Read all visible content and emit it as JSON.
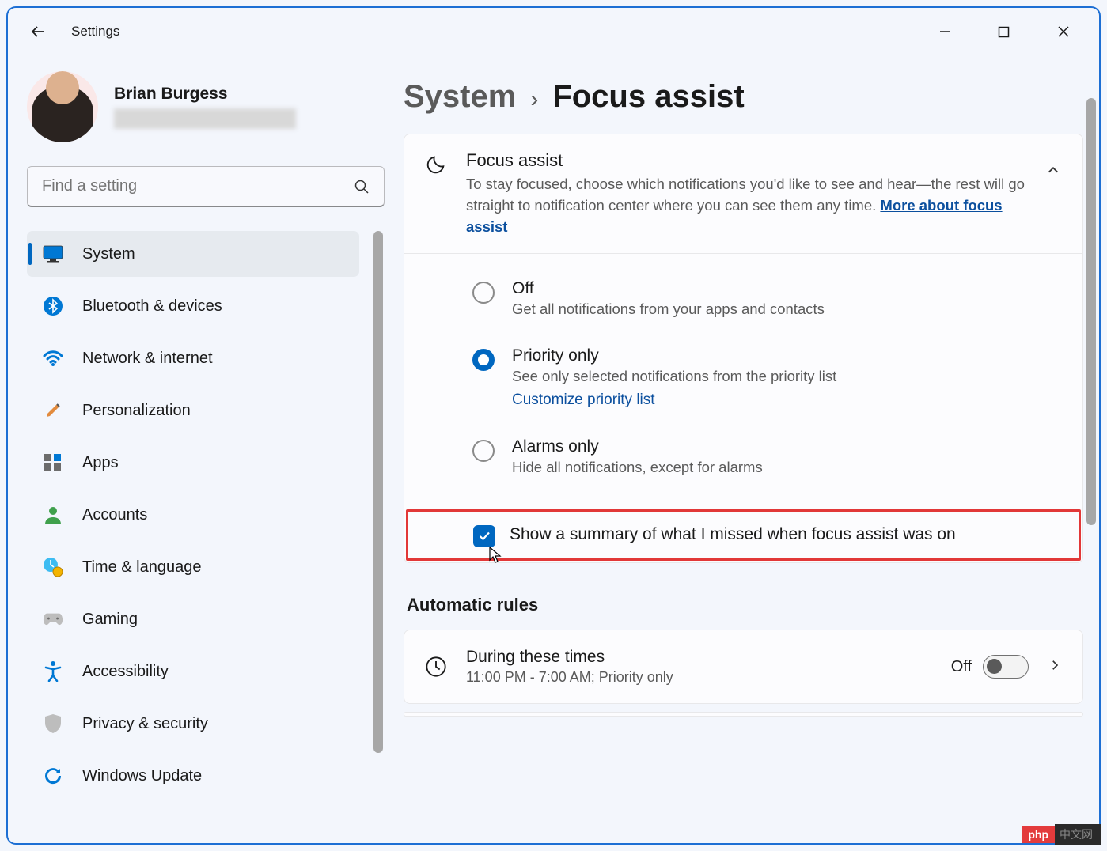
{
  "titlebar": {
    "app_name": "Settings"
  },
  "profile": {
    "name": "Brian Burgess"
  },
  "search": {
    "placeholder": "Find a setting"
  },
  "nav": {
    "items": [
      {
        "label": "System"
      },
      {
        "label": "Bluetooth & devices"
      },
      {
        "label": "Network & internet"
      },
      {
        "label": "Personalization"
      },
      {
        "label": "Apps"
      },
      {
        "label": "Accounts"
      },
      {
        "label": "Time & language"
      },
      {
        "label": "Gaming"
      },
      {
        "label": "Accessibility"
      },
      {
        "label": "Privacy & security"
      },
      {
        "label": "Windows Update"
      }
    ]
  },
  "breadcrumb": {
    "parent": "System",
    "current": "Focus assist"
  },
  "focus_assist": {
    "title": "Focus assist",
    "description": "To stay focused, choose which notifications you'd like to see and hear—the rest will go straight to notification center where you can see them any time.  ",
    "link": "More about focus assist",
    "options": [
      {
        "title": "Off",
        "desc": "Get all notifications from your apps and contacts"
      },
      {
        "title": "Priority only",
        "desc": "See only selected notifications from the priority list",
        "link": "Customize priority list"
      },
      {
        "title": "Alarms only",
        "desc": "Hide all notifications, except for alarms"
      }
    ],
    "summary_checkbox": "Show a summary of what I missed when focus assist was on"
  },
  "auto_rules": {
    "heading": "Automatic rules",
    "rule1": {
      "title": "During these times",
      "desc": "11:00 PM - 7:00 AM; Priority only",
      "state_label": "Off"
    }
  },
  "badge": {
    "php": "php",
    "cn": "中文网"
  }
}
